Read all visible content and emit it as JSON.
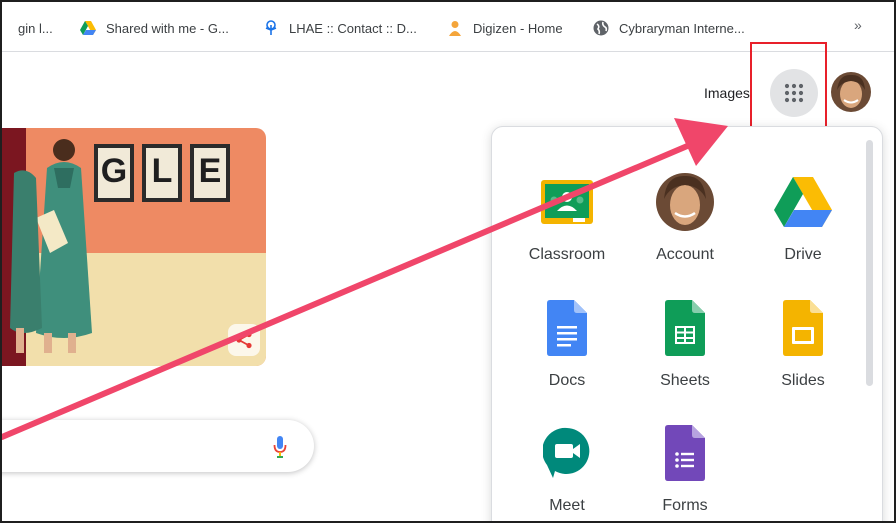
{
  "bookmarks": {
    "items": [
      {
        "label": "gin l...",
        "icon": "page-icon"
      },
      {
        "label": "Shared with me - G...",
        "icon": "google-drive-icon"
      },
      {
        "label": "LHAE :: Contact :: D...",
        "icon": "tree-icon"
      },
      {
        "label": "Digizen - Home",
        "icon": "person-icon"
      },
      {
        "label": "Cybraryman Interne...",
        "icon": "globe-icon"
      }
    ],
    "more": "»"
  },
  "header": {
    "images_label": "Images",
    "apps_icon": "grid-dots-icon",
    "avatar_icon": "avatar"
  },
  "doodle": {
    "letters": [
      "G",
      "L",
      "E"
    ],
    "share_icon": "share-icon"
  },
  "search": {
    "mic_icon": "microphone-icon"
  },
  "apps": [
    {
      "label": "Classroom",
      "icon": "google-classroom-icon"
    },
    {
      "label": "Account",
      "icon": "account-avatar"
    },
    {
      "label": "Drive",
      "icon": "google-drive-icon"
    },
    {
      "label": "Docs",
      "icon": "google-docs-icon"
    },
    {
      "label": "Sheets",
      "icon": "google-sheets-icon"
    },
    {
      "label": "Slides",
      "icon": "google-slides-icon"
    },
    {
      "label": "Meet",
      "icon": "google-meet-icon"
    },
    {
      "label": "Forms",
      "icon": "google-forms-icon"
    }
  ],
  "annotation": {
    "highlight_color": "#e8202a",
    "arrow_color": "#f0466a"
  }
}
